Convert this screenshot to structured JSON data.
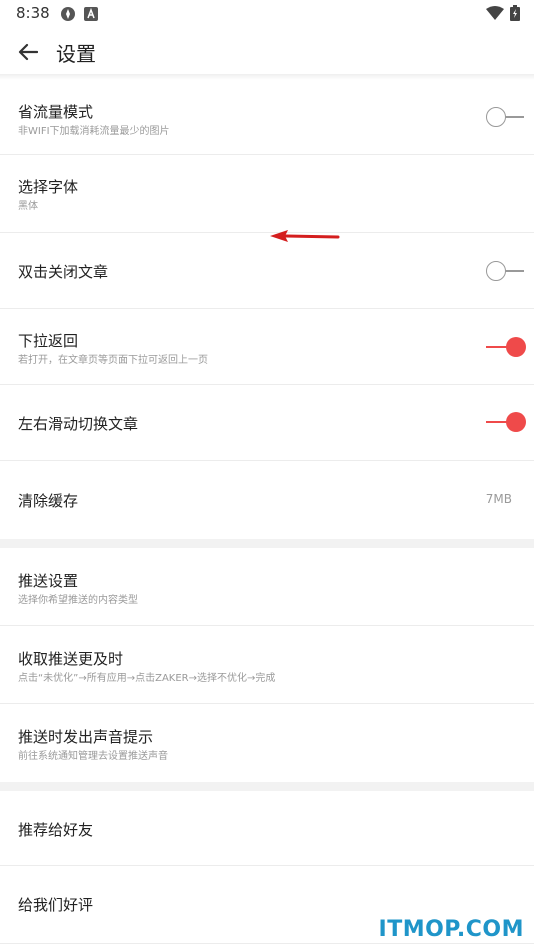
{
  "status_bar": {
    "time": "8:38"
  },
  "app_bar": {
    "title": "设置"
  },
  "settings": {
    "group1": [
      {
        "title": "省流量模式",
        "subtitle": "非WIFI下加载消耗流量最少的图片",
        "toggle": "off"
      },
      {
        "title": "选择字体",
        "subtitle": "黑体"
      },
      {
        "title": "双击关闭文章",
        "toggle": "off"
      },
      {
        "title": "下拉返回",
        "subtitle": "若打开，在文章页等页面下拉可返回上一页",
        "toggle": "on"
      },
      {
        "title": "左右滑动切换文章",
        "toggle": "on"
      },
      {
        "title": "清除缓存",
        "value": "7MB"
      }
    ],
    "group2": [
      {
        "title": "推送设置",
        "subtitle": "选择你希望推送的内容类型"
      },
      {
        "title": "收取推送更及时",
        "subtitle": "点击“未优化”→所有应用→点击ZAKER→选择不优化→完成"
      },
      {
        "title": "推送时发出声音提示",
        "subtitle": "前往系统通知管理去设置推送声音"
      }
    ],
    "group3": [
      {
        "title": "推荐给好友"
      },
      {
        "title": "给我们好评"
      }
    ]
  },
  "colors": {
    "accent": "#ef4a4a",
    "watermark": "#1f95c9"
  },
  "watermark": "ITMOP.COM"
}
